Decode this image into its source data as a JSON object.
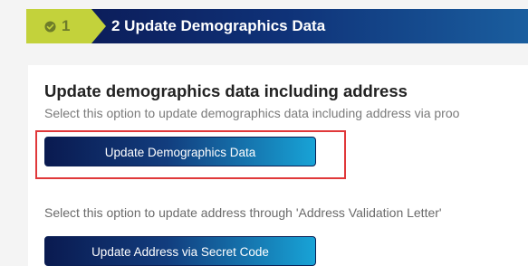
{
  "step": {
    "number": "1",
    "title": "2 Update Demographics Data"
  },
  "options": {
    "heading": "Update demographics data including address",
    "primary_description": "Select this option to update demographics data including address via proo",
    "primary_button_label": "Update Demographics Data",
    "secondary_description": "Select this option to update address through 'Address Validation Letter'",
    "secondary_button_label": "Update Address via Secret Code"
  },
  "icons": {
    "step_status": "check-circle-icon"
  },
  "colors": {
    "step_badge": "#c3d23b",
    "header_bar": "#0c1d5a",
    "button_start": "#0a1a50",
    "button_end": "#18a3d6",
    "highlight_border": "#e0383a"
  }
}
